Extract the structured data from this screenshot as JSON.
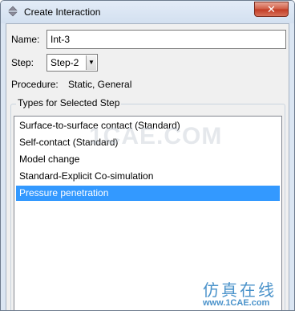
{
  "window": {
    "title": "Create Interaction",
    "close_label": "✕"
  },
  "form": {
    "name_label": "Name:",
    "name_value": "Int-3",
    "step_label": "Step:",
    "step_value": "Step-2",
    "procedure_label": "Procedure:",
    "procedure_value": "Static, General"
  },
  "types": {
    "group_title": "Types for Selected Step",
    "items": [
      {
        "label": "Surface-to-surface contact (Standard)",
        "selected": false
      },
      {
        "label": "Self-contact (Standard)",
        "selected": false
      },
      {
        "label": "Model change",
        "selected": false
      },
      {
        "label": "Standard-Explicit Co-simulation",
        "selected": false
      },
      {
        "label": "Pressure penetration",
        "selected": true
      }
    ]
  },
  "watermark": {
    "center_text": "1CAE.COM",
    "cn_text": "仿真在线",
    "url_text": "www.1CAE.com"
  },
  "colors": {
    "selection": "#3399ff",
    "title_bar": "#dbe6f3",
    "close_button": "#c23a23",
    "watermark": "#2a7fc1"
  }
}
